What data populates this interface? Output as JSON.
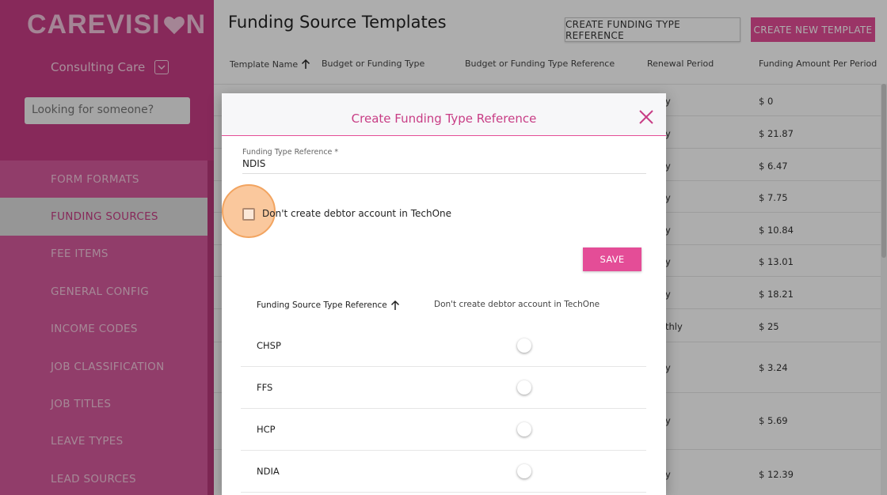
{
  "sidebar": {
    "logo_left": "CAREVISI",
    "logo_right": "N",
    "org_name": "Consulting Care",
    "search_placeholder": "Looking for someone?",
    "items": [
      {
        "label": "FORM FORMATS"
      },
      {
        "label": "FUNDING SOURCES"
      },
      {
        "label": "FEE ITEMS"
      },
      {
        "label": "GENERAL CONFIG"
      },
      {
        "label": "INCOME CODES"
      },
      {
        "label": "JOB CLASSIFICATION"
      },
      {
        "label": "JOB TITLES"
      },
      {
        "label": "LEAVE TYPES"
      },
      {
        "label": "LEAD SOURCES"
      }
    ]
  },
  "header": {
    "title": "Funding Source Templates",
    "create_reference_label": "CREATE FUNDING TYPE REFERENCE",
    "create_template_label": "CREATE NEW TEMPLATE"
  },
  "table": {
    "columns": [
      "Template Name",
      "Budget or Funding Type",
      "Budget or Funding Type Reference",
      "Renewal Period",
      "Funding Amount Per Period"
    ],
    "rows": [
      {
        "renewal": "y",
        "amount": "$ 0"
      },
      {
        "renewal": "y",
        "amount": "$ 21.87"
      },
      {
        "renewal": "y",
        "amount": "$ 6.47"
      },
      {
        "renewal": "y",
        "amount": "$ 7.75"
      },
      {
        "renewal": "y",
        "amount": "$ 10.84"
      },
      {
        "renewal": "y",
        "amount": "$ 13.01"
      },
      {
        "renewal": "y",
        "amount": "$ 18.21"
      },
      {
        "renewal": "thly",
        "amount": "$ 25"
      },
      {
        "renewal": "y",
        "amount": "$ 3.24"
      },
      {
        "renewal": "",
        "amount": ""
      },
      {
        "renewal": "y",
        "amount": "$ 5.69"
      },
      {
        "renewal": "",
        "amount": ""
      },
      {
        "renewal": "y",
        "amount": "$ 12.39"
      }
    ]
  },
  "modal": {
    "title": "Create Funding Type Reference",
    "field_label": "Funding Type Reference *",
    "field_value": "NDIS",
    "checkbox_label": "Don't create debtor account in TechOne",
    "save_label": "SAVE",
    "table_headers": [
      "Funding Source Type Reference",
      "Don't create debtor account in TechOne"
    ],
    "table_rows": [
      {
        "label": "CHSP"
      },
      {
        "label": "FFS"
      },
      {
        "label": "HCP"
      },
      {
        "label": "NDIA"
      }
    ]
  }
}
